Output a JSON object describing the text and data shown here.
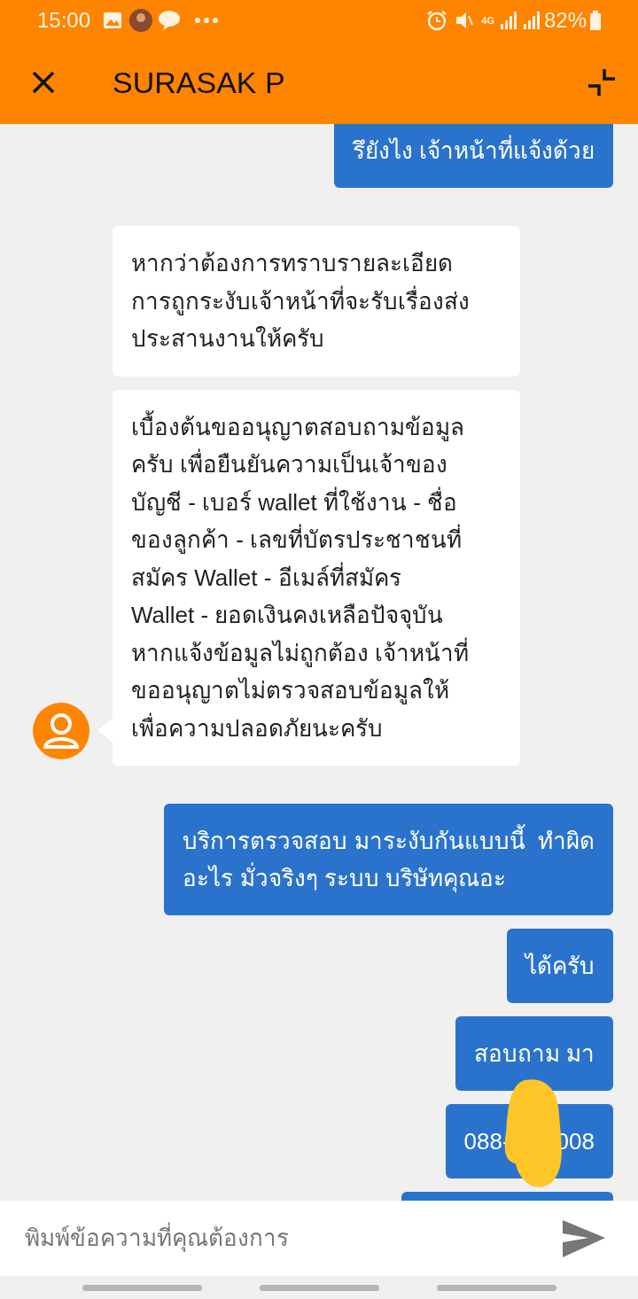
{
  "status_bar": {
    "time": "15:00",
    "network": "4G",
    "battery": "82%"
  },
  "header": {
    "title": "SURASAK P"
  },
  "messages": [
    {
      "kind": "outgoing",
      "lines": [
        "รึยังไง เจ้าหน้าที่แจ้งด้วย"
      ]
    },
    {
      "kind": "incoming",
      "lines": [
        "หากว่าต้องการทราบรายละเอียด",
        "การถูกระงับเจ้าหน้าที่จะรับเรื่องส่ง",
        "ประสานงานให้ครับ"
      ]
    },
    {
      "kind": "incoming",
      "lines": [
        "เบื้องต้นขออนุญาตสอบถามข้อมูล",
        "ครับ เพื่อยืนยันความเป็นเจ้าของ",
        "บัญชี - เบอร์ wallet ที่ใช้งาน - ชื่อ",
        "ของลูกค้า - เลขที่บัตรประชาชนที่",
        "สมัคร Wallet - อีเมล์ที่สมัคร",
        "Wallet - ยอดเงินคงเหลือปัจจุบัน",
        "หากแจ้งข้อมูลไม่ถูกต้อง เจ้าหน้าที่",
        "ขออนุญาตไม่ตรวจสอบข้อมูลให้",
        "เพื่อความปลอดภัยนะครับ"
      ]
    },
    {
      "kind": "outgoing",
      "lines": [
        "บริการตรวจสอบ มาระงับกันแบบนี้  ทำผิด",
        "อะไร มั่วจริงๆ ระบบ บริษัทคุณอะ"
      ]
    },
    {
      "kind": "outgoing",
      "lines": [
        "ได้ครับ"
      ]
    },
    {
      "kind": "outgoing",
      "lines": [
        "สอบถาม มา"
      ]
    },
    {
      "kind": "redacted",
      "parts": [
        "088-",
        "008"
      ]
    },
    {
      "kind": "outgoing"
    }
  ],
  "composer": {
    "placeholder": "พิมพ์ข้อความที่คุณต้องการ"
  }
}
